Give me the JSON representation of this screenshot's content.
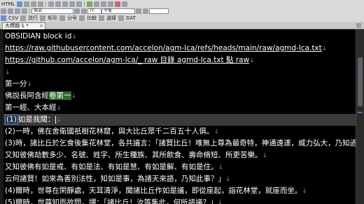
{
  "toolbar": {
    "row1_label": "HTML",
    "search_value": "佛弟",
    "search_target_value": "今後",
    "encoding_value": "TF",
    "row3_labels": [
      "CSV",
      "改行",
      "矩形",
      "分号",
      "比較",
      "選择",
      "DAT"
    ]
  },
  "tab": {
    "label": "大標題-1 *",
    "close": "×"
  },
  "editor": {
    "line_ending_mark": "↓",
    "lines": [
      "OBSIDIAN block id",
      "https://raw.githubusercontent.com/accelon/agm-lca/refs/heads/main/raw/agmd-lca.txt",
      "https://github.com/accelon/agm-lca/_ raw 目錄 agmd-lca.txt 點 raw",
      "",
      "第一分",
      "佛說長阿含經卷第一",
      "第一經、大本經",
      "(1)如是我聞：",
      "(2)一時，佛在舍衛國祇樹花林窟，與大比丘眾千二百五十人俱。",
      "(3)時，諸比丘於乞食後集花林堂，各共議言：「諸賢比丘！唯無上尊為最奇特，神通遠達，威力弘大，乃知過",
      "又知彼佛劫數多少、名號、姓字、所生種族、其所飲食、壽命脩短、所更苦樂。",
      "又知彼佛有如是戒、有如是法、有如是慧、有如是解、有如是住。",
      "云何諸賢！如來為善別法性，知如是事，為諸天來語，乃知此事？」",
      "(4)爾時，世尊在閑靜處，天耳清淨，聞諸比丘作如是議，即從座起，詣花林堂，就座而坐。",
      "(5)爾時，世尊知而故問，謂：「諸比丘！汝等集此，何所語議？」"
    ],
    "line5_plain": "佛說長阿含經",
    "line5_highlight": "卷第一",
    "line7_number": "(1)",
    "line7_rest": "如是我聞："
  }
}
